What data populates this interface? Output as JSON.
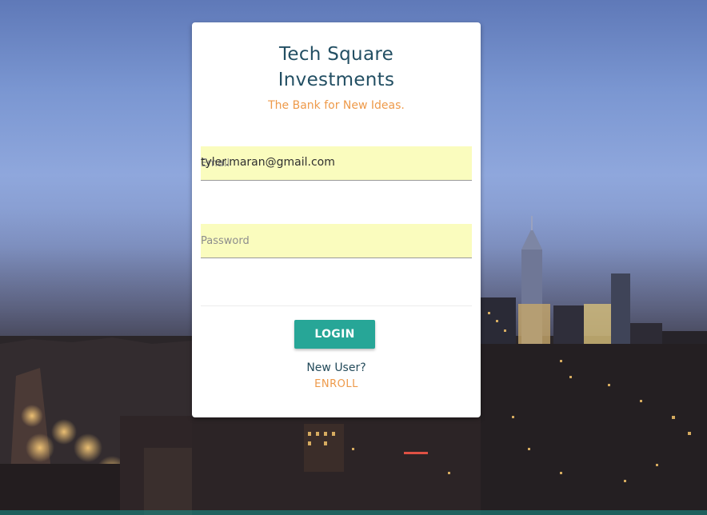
{
  "brand": {
    "title_line1": "Tech Square",
    "title_line2": "Investments",
    "tagline": "The Bank for New Ideas."
  },
  "form": {
    "email_label": "Email",
    "email_value": "tyler.maran@gmail.com",
    "password_label": "Password",
    "login_label": "LOGIN"
  },
  "footer": {
    "new_user_text": "New User?",
    "enroll_label": "ENROLL"
  },
  "colors": {
    "title": "#234f63",
    "accent_orange": "#ee9a4a",
    "button_teal": "#27a697",
    "autofill_yellow": "#fafcbe"
  }
}
